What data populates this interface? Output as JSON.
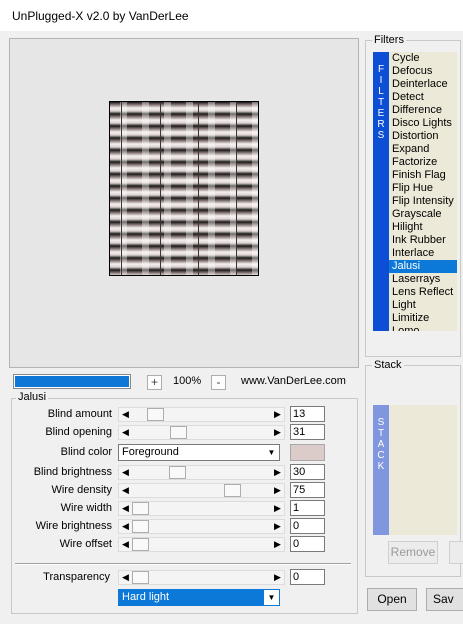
{
  "window": {
    "title": "UnPlugged-X v2.0 by VanDerLee"
  },
  "preview": {
    "zoom_minus": "-",
    "zoom_plus": "+",
    "zoom": "100%",
    "website": "www.VanDerLee.com",
    "progress": 1.0
  },
  "jalusi": {
    "group_title": "Jalusi",
    "params": [
      {
        "label": "Blind amount",
        "value": "13",
        "fraction": 0.12
      },
      {
        "label": "Blind opening",
        "value": "31",
        "fraction": 0.31
      },
      {
        "label": "Blind brightness",
        "value": "30",
        "fraction": 0.3
      },
      {
        "label": "Wire density",
        "value": "75",
        "fraction": 0.75
      },
      {
        "label": "Wire width",
        "value": "1",
        "fraction": 0.0
      },
      {
        "label": "Wire brightness",
        "value": "0",
        "fraction": 0.0
      },
      {
        "label": "Wire offset",
        "value": "0",
        "fraction": 0.0
      }
    ],
    "blind_color": {
      "label": "Blind color",
      "selected": "Foreground",
      "swatch": "#dcccc9"
    },
    "transparency": {
      "label": "Transparency",
      "value": "0",
      "fraction": 0.0
    },
    "blend_mode": {
      "selected": "Hard light"
    }
  },
  "filters": {
    "group_title": "Filters",
    "side_letters": [
      "F",
      "I",
      "L",
      "T",
      "E",
      "R",
      "S"
    ],
    "items": [
      "Cycle",
      "Defocus",
      "Deinterlace",
      "Detect",
      "Difference",
      "Disco Lights",
      "Distortion",
      "Expand",
      "Factorize",
      "Finish Flag",
      "Flip Hue",
      "Flip Intensity",
      "Grayscale",
      "Hilight",
      "Ink Rubber",
      "Interlace",
      "Jalusi",
      "Laserrays",
      "Lens Reflect",
      "Light",
      "Limitize",
      "Lomo"
    ],
    "selected": "Jalusi"
  },
  "stack": {
    "group_title": "Stack",
    "side_letters": [
      "S",
      "T",
      "A",
      "C",
      "K"
    ],
    "remove_label": "Remove"
  },
  "footer": {
    "open_label": "Open",
    "save_label": "Sav"
  },
  "icons": {
    "arrow_left": "◀",
    "arrow_right": "▶",
    "dropdown": "▼"
  },
  "colors": {
    "accent": "#0c78d7",
    "filters_side": "#0c4ed4",
    "stack_side": "#8096de",
    "list_bg": "#ece9d8"
  }
}
